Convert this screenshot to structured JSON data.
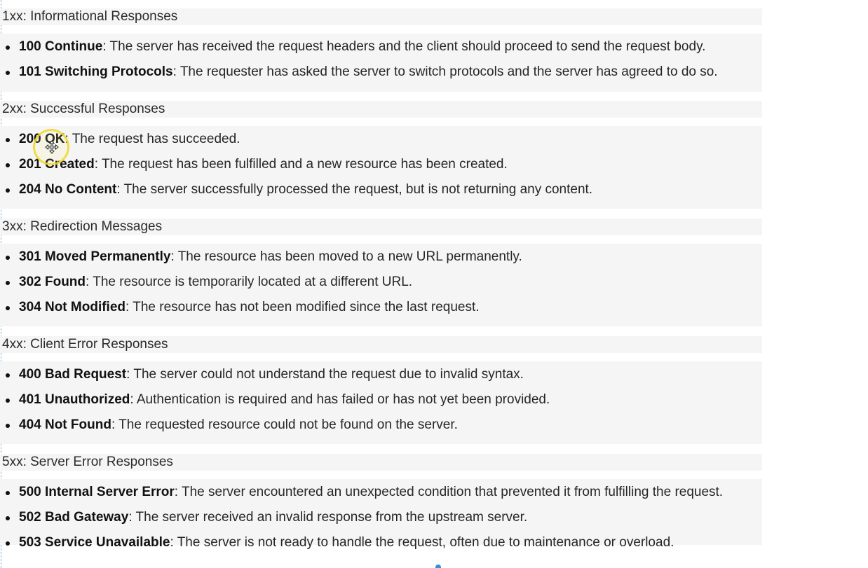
{
  "sections": [
    {
      "title": "1xx: Informational Responses",
      "items": [
        {
          "code": "100 Continue",
          "desc": ": The server has received the request headers and the client should proceed to send the request body."
        },
        {
          "code": "101 Switching Protocols",
          "desc": ": The requester has asked the server to switch protocols and the server has agreed to do so."
        }
      ]
    },
    {
      "title": "2xx: Successful Responses",
      "items": [
        {
          "code": "200 OK",
          "desc": ": The request has succeeded."
        },
        {
          "code": "201 Created",
          "desc": ": The request has been fulfilled and a new resource has been created."
        },
        {
          "code": "204 No Content",
          "desc": ": The server successfully processed the request, but is not returning any content."
        }
      ]
    },
    {
      "title": "3xx: Redirection Messages",
      "items": [
        {
          "code": "301 Moved Permanently",
          "desc": ": The resource has been moved to a new URL permanently."
        },
        {
          "code": "302 Found",
          "desc": ": The resource is temporarily located at a different URL."
        },
        {
          "code": "304 Not Modified",
          "desc": ": The resource has not been modified since the last request."
        }
      ]
    },
    {
      "title": "4xx: Client Error Responses",
      "items": [
        {
          "code": "400 Bad Request",
          "desc": ": The server could not understand the request due to invalid syntax."
        },
        {
          "code": "401 Unauthorized",
          "desc": ": Authentication is required and has failed or has not yet been provided."
        },
        {
          "code": "404 Not Found",
          "desc": ": The requested resource could not be found on the server."
        }
      ]
    },
    {
      "title": "5xx: Server Error Responses",
      "items": [
        {
          "code": "500 Internal Server Error",
          "desc": ": The server encountered an unexpected condition that prevented it from fulfilling the request."
        },
        {
          "code": "502 Bad Gateway",
          "desc": ": The server received an invalid response from the upstream server."
        },
        {
          "code": "503 Service Unavailable",
          "desc": ": The server is not ready to handle the request, often due to maintenance or overload."
        }
      ]
    }
  ],
  "cursor": {
    "icon": "move-cursor-icon",
    "highlight_color": "#f0d728"
  },
  "colors": {
    "band_background": "#f5f5f5",
    "guide_line": "#7fb2d8"
  }
}
